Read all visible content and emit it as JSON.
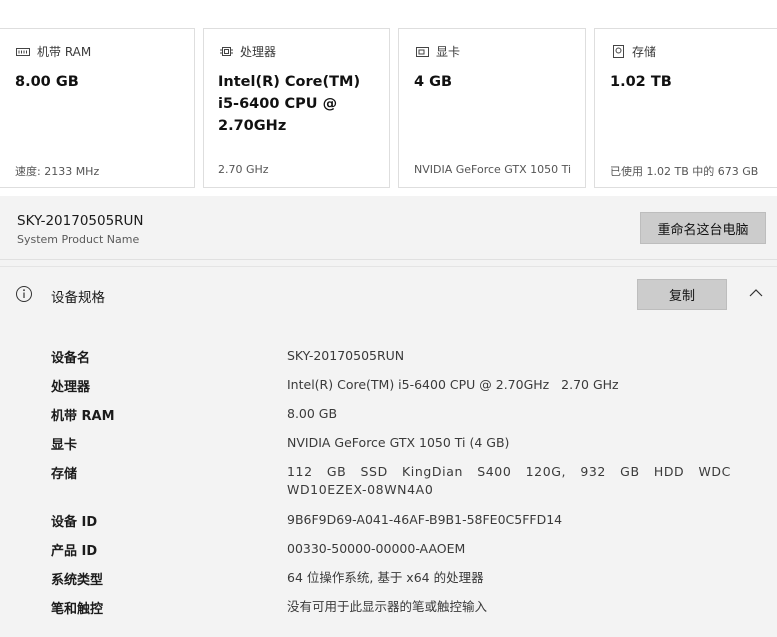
{
  "cards": [
    {
      "header": "机带 RAM",
      "icon": "memory-icon",
      "value": "8.00 GB",
      "foot": "速度: 2133 MHz"
    },
    {
      "header": "处理器",
      "icon": "processor-icon",
      "value": "Intel(R) Core(TM) i5-6400 CPU @ 2.70GHz",
      "foot": "2.70 GHz"
    },
    {
      "header": "显卡",
      "icon": "graphics-card-icon",
      "value": "4 GB",
      "foot": "NVIDIA GeForce GTX 1050 Ti"
    },
    {
      "header": "存储",
      "icon": "storage-icon",
      "value": "1.02 TB",
      "foot": "已使用 1.02 TB 中的 673 GB"
    }
  ],
  "computer": {
    "name": "SKY-20170505RUN",
    "subtitle": "System Product Name",
    "rename_label": "重命名这台电脑"
  },
  "specs": {
    "title": "设备规格",
    "info_icon": "info-icon",
    "copy_label": "复制",
    "collapse_icon": "chevron-up-icon",
    "rows": [
      {
        "label": "设备名",
        "value": "SKY-20170505RUN"
      },
      {
        "label": "处理器",
        "value": "Intel(R) Core(TM) i5-6400 CPU @ 2.70GHz   2.70 GHz"
      },
      {
        "label": "机带 RAM",
        "value": "8.00 GB"
      },
      {
        "label": "显卡",
        "value": "NVIDIA GeForce GTX 1050 Ti (4 GB)"
      },
      {
        "label": "存储",
        "value": "112 GB SSD KingDian S400 120G, 932 GB HDD WDC WD10EZEX-08WN4A0"
      },
      {
        "label": "设备 ID",
        "value": "9B6F9D69-A041-46AF-B9B1-58FE0C5FFD14"
      },
      {
        "label": "产品 ID",
        "value": "00330-50000-00000-AAOEM"
      },
      {
        "label": "系统类型",
        "value": "64 位操作系统, 基于 x64 的处理器"
      },
      {
        "label": "笔和触控",
        "value": "没有可用于此显示器的笔或触控输入"
      }
    ]
  }
}
